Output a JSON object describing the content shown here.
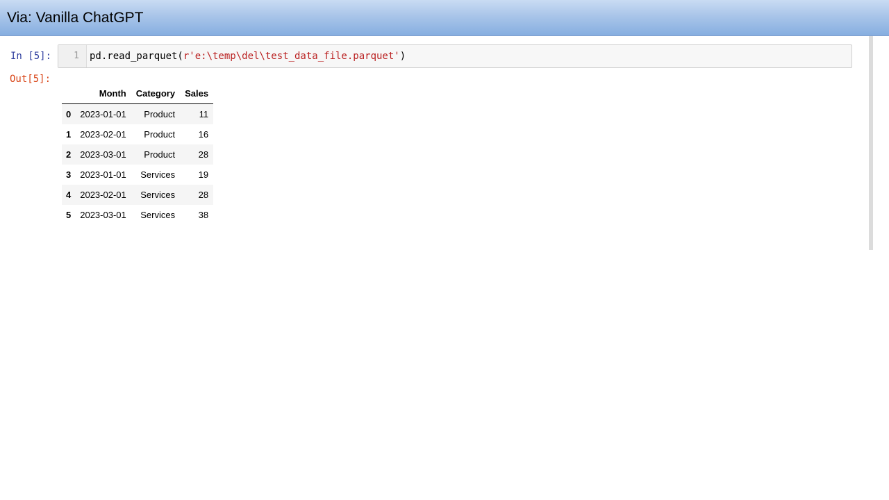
{
  "title_bar": {
    "title": "Via: Vanilla ChatGPT"
  },
  "notebook": {
    "input_prompt": "In [5]:",
    "output_prompt": "Out[5]:",
    "code_cell": {
      "line_number": "1",
      "code_prefix": "pd.read_parquet(",
      "code_string": "r'e:\\temp\\del\\test_data_file.parquet'",
      "code_suffix": ")"
    },
    "dataframe": {
      "columns": [
        "Month",
        "Category",
        "Sales"
      ],
      "rows": [
        {
          "index": "0",
          "Month": "2023-01-01",
          "Category": "Product",
          "Sales": "11"
        },
        {
          "index": "1",
          "Month": "2023-02-01",
          "Category": "Product",
          "Sales": "16"
        },
        {
          "index": "2",
          "Month": "2023-03-01",
          "Category": "Product",
          "Sales": "28"
        },
        {
          "index": "3",
          "Month": "2023-01-01",
          "Category": "Services",
          "Sales": "19"
        },
        {
          "index": "4",
          "Month": "2023-02-01",
          "Category": "Services",
          "Sales": "28"
        },
        {
          "index": "5",
          "Month": "2023-03-01",
          "Category": "Services",
          "Sales": "38"
        }
      ]
    }
  },
  "colors": {
    "title_gradient_top": "#c9dcf3",
    "title_gradient_bottom": "#86aee0",
    "input_prompt": "#303f9f",
    "output_prompt": "#d84315",
    "code_string": "#ba2121"
  }
}
